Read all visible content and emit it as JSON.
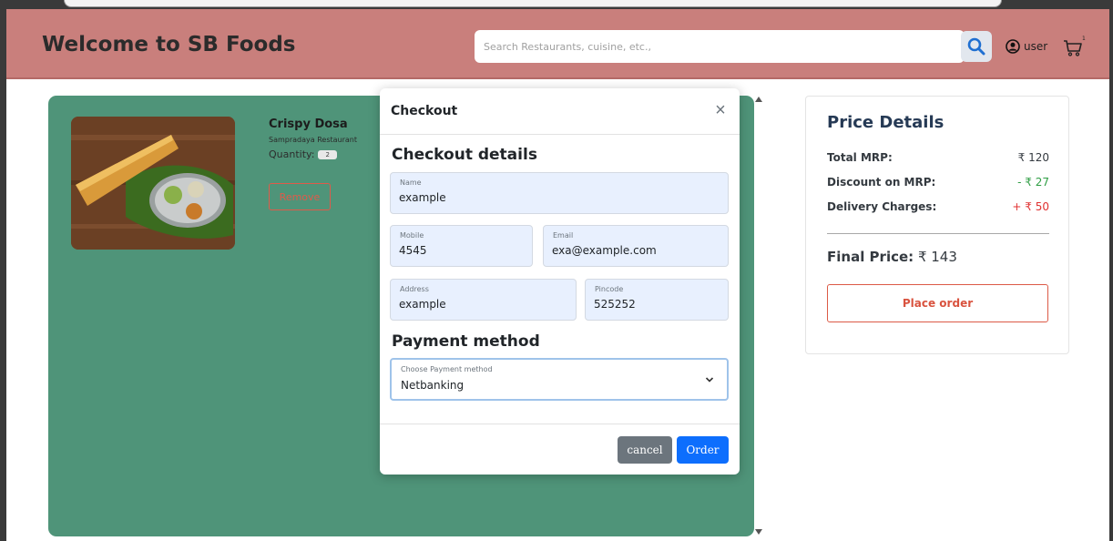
{
  "navbar": {
    "brand": "Welcome to SB Foods",
    "search_placeholder": "Search Restaurants, cuisine, etc.,",
    "user_label": "user",
    "cart_count": "1"
  },
  "cart": {
    "items": [
      {
        "title": "Crispy Dosa",
        "restaurant": "Sampradaya Restaurant",
        "quantity_label": "Quantity:",
        "quantity": "2",
        "remove_label": "Remove"
      }
    ]
  },
  "price_details": {
    "title": "Price Details",
    "rows": [
      {
        "label": "Total MRP:",
        "value": "₹ 120",
        "color": "#343a40"
      },
      {
        "label": "Discount on MRP:",
        "value": "- ₹ 27",
        "color": "#2f9e44"
      },
      {
        "label": "Delivery Charges:",
        "value": "+ ₹ 50",
        "color": "#e03131"
      }
    ],
    "final_label": "Final Price:",
    "final_value": "₹ 143",
    "place_order_label": "Place order"
  },
  "modal": {
    "title": "Checkout",
    "details_heading": "Checkout details",
    "fields": {
      "name": {
        "label": "Name",
        "value": "example"
      },
      "mobile": {
        "label": "Mobile",
        "value": "4545"
      },
      "email": {
        "label": "Email",
        "value": "exa@example.com"
      },
      "address": {
        "label": "Address",
        "value": "example"
      },
      "pincode": {
        "label": "Pincode",
        "value": "525252"
      }
    },
    "payment_heading": "Payment method",
    "payment": {
      "label": "Choose Payment method",
      "value": "Netbanking"
    },
    "cancel_label": "cancel",
    "order_label": "Order"
  },
  "colors": {
    "navbar": "#c97f7c",
    "cart_panel": "#4f9479",
    "primary": "#0d6efd",
    "secondary": "#6c757d",
    "danger": "#dc5a46"
  }
}
